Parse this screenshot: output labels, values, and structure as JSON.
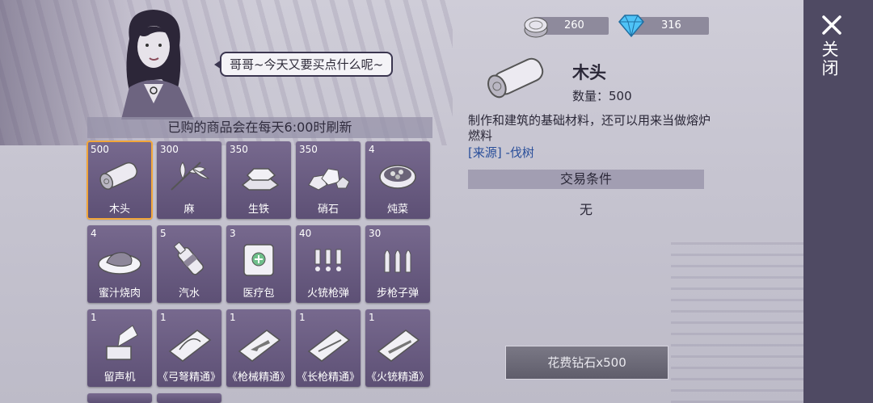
{
  "npc": {
    "speech": "哥哥~今天又要买点什么呢~"
  },
  "shop": {
    "refresh_notice": "已购的商品会在每天6:00时刷新",
    "items": [
      {
        "qty": "500",
        "name": "木头",
        "icon": "wood-log-icon",
        "selected": true
      },
      {
        "qty": "300",
        "name": "麻",
        "icon": "hemp-plant-icon"
      },
      {
        "qty": "350",
        "name": "生铁",
        "icon": "iron-ingot-icon"
      },
      {
        "qty": "350",
        "name": "硝石",
        "icon": "saltpeter-rocks-icon"
      },
      {
        "qty": "4",
        "name": "炖菜",
        "icon": "stew-pot-icon"
      },
      {
        "qty": "4",
        "name": "蜜汁烧肉",
        "icon": "roast-meat-plate-icon"
      },
      {
        "qty": "5",
        "name": "汽水",
        "icon": "soda-bottle-icon"
      },
      {
        "qty": "3",
        "name": "医疗包",
        "icon": "medkit-icon"
      },
      {
        "qty": "40",
        "name": "火铳枪弹",
        "icon": "musket-ammo-icon"
      },
      {
        "qty": "30",
        "name": "步枪子弹",
        "icon": "rifle-ammo-icon"
      },
      {
        "qty": "1",
        "name": "留声机",
        "icon": "gramophone-icon"
      },
      {
        "qty": "1",
        "name": "《弓弩精通》",
        "icon": "bow-book-icon"
      },
      {
        "qty": "1",
        "name": "《枪械精通》",
        "icon": "gun-book-icon"
      },
      {
        "qty": "1",
        "name": "《长枪精通》",
        "icon": "spear-book-icon"
      },
      {
        "qty": "1",
        "name": "《火铳精通》",
        "icon": "musket-book-icon"
      }
    ]
  },
  "currency": {
    "coins": "260",
    "diamonds": "316",
    "coin_icon": "coin-icon",
    "diamond_icon": "diamond-icon",
    "diamond_color": "#4fc3f7"
  },
  "detail": {
    "name": "木头",
    "qty_label": "数量：500",
    "description": "制作和建筑的基础材料，还可以用来当做熔炉燃料",
    "source_tag": "[来源]",
    "source_value": "-伐树",
    "trade_title": "交易条件",
    "trade_value": "无"
  },
  "buy_button": "花费钻石x500",
  "close_label": "关闭",
  "colors": {
    "selected_border": "#f2a63a",
    "item_bg": "#6a5d82",
    "close_panel": "#4f4a63"
  }
}
